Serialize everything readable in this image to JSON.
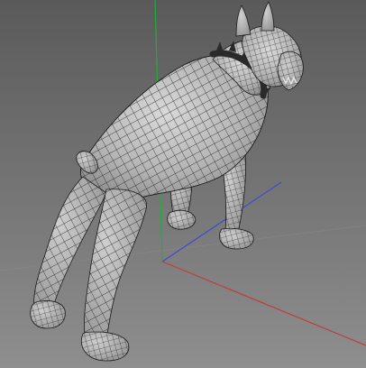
{
  "viewport": {
    "background_top": "#5a5a5a",
    "background_bottom": "#8e8e8e",
    "grid_line_color": "#9a9a9a"
  },
  "axes": {
    "x_color": "#c03c3c",
    "y_color": "#1fae3a",
    "z_color": "#3c4bd8"
  },
  "model": {
    "mesh_fill_light": "#d9d9d9",
    "mesh_fill_shadow": "#7d7d7d",
    "wire_color": "#1a1a1a",
    "collar_color": "#2a2a2a"
  }
}
